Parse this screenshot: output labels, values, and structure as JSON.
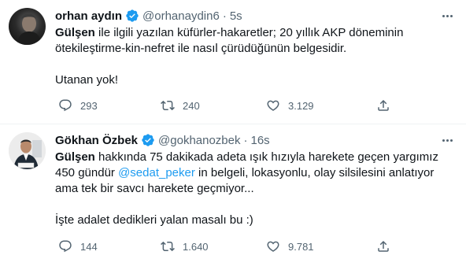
{
  "tweets": [
    {
      "name": "orhan aydın",
      "handle": "@orhanaydin6",
      "separator": "·",
      "time": "5s",
      "text": {
        "bold": "Gülşen",
        "line1_rest": " ile ilgili yazılan küfürler-hakaretler; 20 yıllık AKP döneminin",
        "line2": "ötekileştirme-kin-nefret ile nasıl çürüdüğünün belgesidir.",
        "line3": "",
        "line4": "Utanan yok!"
      },
      "replies": "293",
      "retweets": "240",
      "likes": "3.129"
    },
    {
      "name": "Gökhan Özbek",
      "handle": "@gokhanozbek",
      "separator": "·",
      "time": "16s",
      "text": {
        "bold": "Gülşen",
        "line1_rest": " hakkında 75 dakikada adeta ışık hızıyla harekete geçen yargımız",
        "line2_pre": "450 gündür ",
        "mention": "@sedat_peker",
        "line2_post": " in belgeli, lokasyonlu, olay silsilesini anlatıyor",
        "line3": "ama tek bir savcı harekete geçmiyor...",
        "line4": "",
        "line5": "İşte adalet dedikleri yalan masalı bu :)"
      },
      "replies": "144",
      "retweets": "1.640",
      "likes": "9.781"
    }
  ],
  "colors": {
    "accent": "#1d9bf0",
    "secondary_text": "#536471",
    "primary_text": "#0f1419",
    "divider": "#eff3f4"
  },
  "icons": [
    "verified-badge-icon",
    "more-icon",
    "reply-icon",
    "retweet-icon",
    "like-icon",
    "share-icon"
  ]
}
